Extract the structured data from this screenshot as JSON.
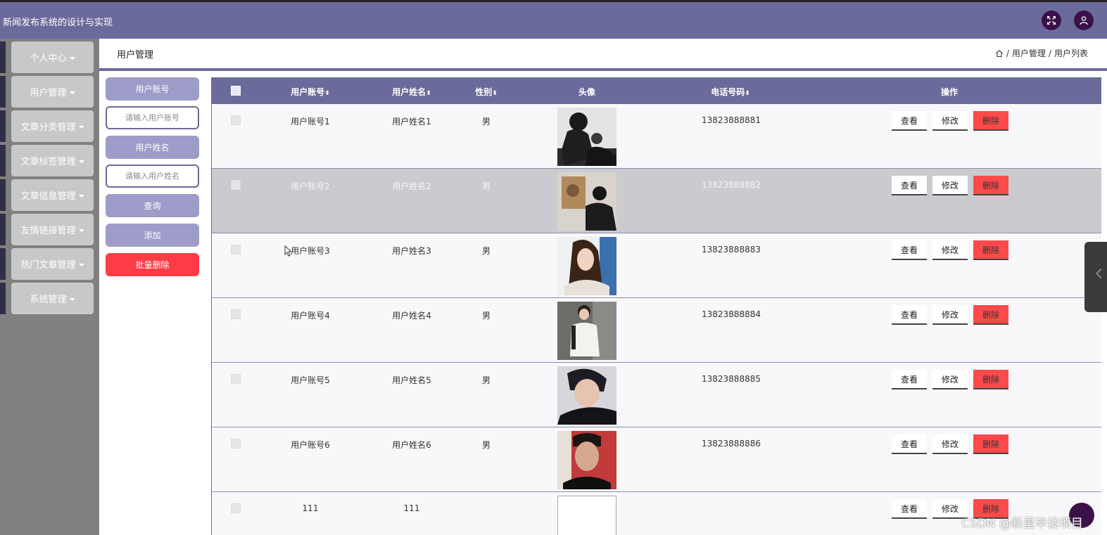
{
  "app": {
    "title": "新闻发布系统的设计与实现"
  },
  "topbar": {
    "fullscreen_icon": "expand-icon",
    "user_icon": "user-icon"
  },
  "sidebar": {
    "items": [
      {
        "label": "个人中心"
      },
      {
        "label": "用户管理"
      },
      {
        "label": "文章分类管理"
      },
      {
        "label": "文章标签管理"
      },
      {
        "label": "文章信息管理"
      },
      {
        "label": "友情链接管理"
      },
      {
        "label": "热门文章管理"
      },
      {
        "label": "系统管理"
      }
    ]
  },
  "header": {
    "title": "用户管理",
    "breadcrumb": {
      "sep": "/",
      "level1": "用户管理",
      "level2": "用户列表"
    }
  },
  "search": {
    "account_label": "用户账号",
    "account_placeholder": "请输入用户账号",
    "name_label": "用户姓名",
    "name_placeholder": "请输入用户姓名",
    "query_label": "查询",
    "add_label": "添加",
    "batch_delete_label": "批量删除"
  },
  "table": {
    "columns": {
      "account": "用户账号",
      "name": "用户姓名",
      "gender": "性别",
      "avatar": "头像",
      "phone": "电话号码",
      "actions": "操作"
    },
    "sort_glyph": "⬍",
    "actions": {
      "view": "查看",
      "edit": "修改",
      "delete": "删除"
    },
    "rows": [
      {
        "account": "用户账号1",
        "name": "用户姓名1",
        "gender": "男",
        "phone": "13823888881"
      },
      {
        "account": "用户账号2",
        "name": "用户姓名2",
        "gender": "男",
        "phone": "13823888882"
      },
      {
        "account": "用户账号3",
        "name": "用户姓名3",
        "gender": "男",
        "phone": "13823888883"
      },
      {
        "account": "用户账号4",
        "name": "用户姓名4",
        "gender": "男",
        "phone": "13823888884"
      },
      {
        "account": "用户账号5",
        "name": "用户姓名5",
        "gender": "男",
        "phone": "13823888885"
      },
      {
        "account": "用户账号6",
        "name": "用户姓名6",
        "gender": "男",
        "phone": "13823888886"
      },
      {
        "account": "111",
        "name": "111",
        "gender": "",
        "phone": ""
      }
    ]
  },
  "watermark": "CSDN @新星毕设项目"
}
